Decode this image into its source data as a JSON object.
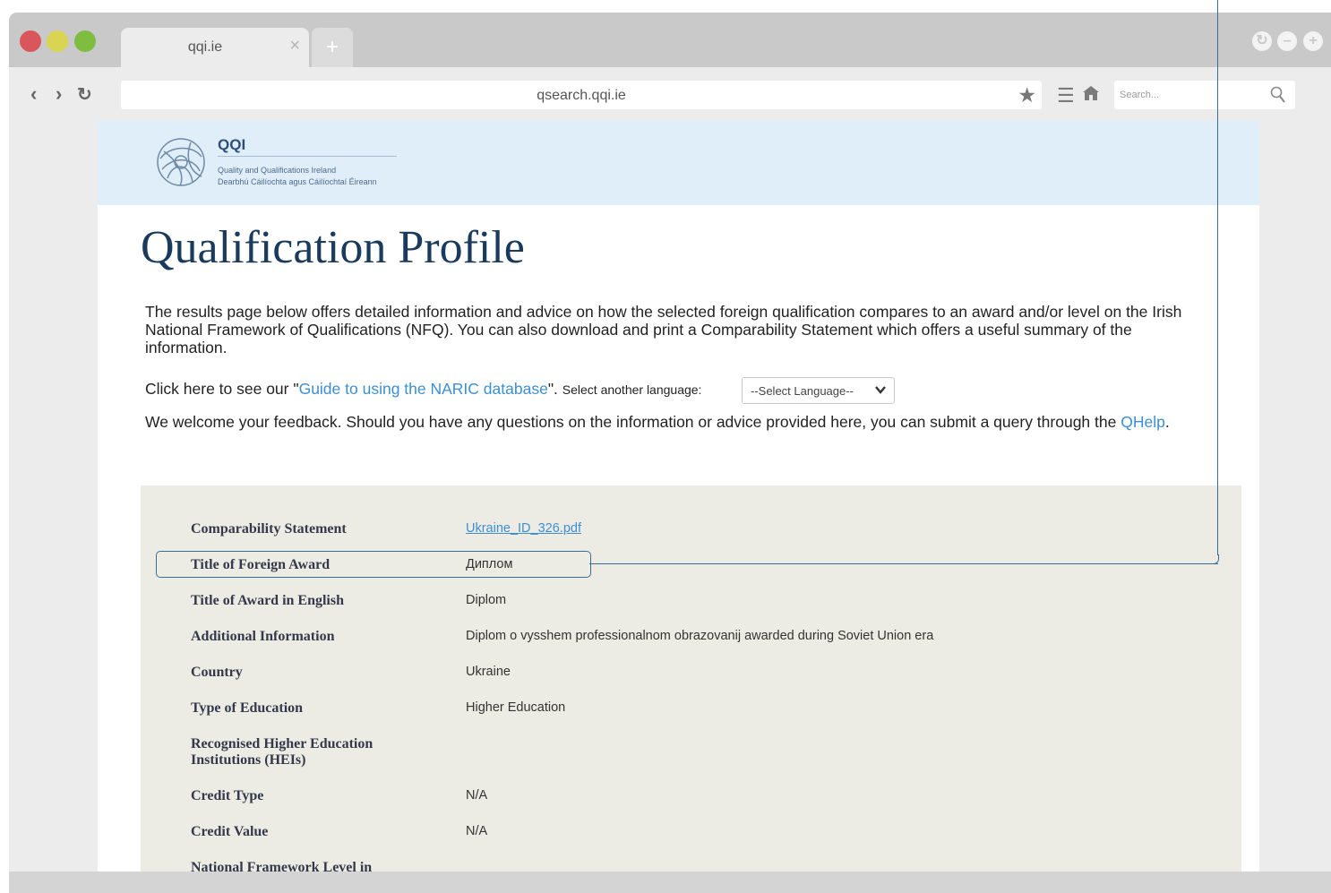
{
  "browser": {
    "tab_title": "qqi.ie",
    "tab_close": "×",
    "new_tab": "+",
    "url": "qsearch.qqi.ie",
    "search_placeholder": "Search...",
    "colors": {
      "close": "#d9575b",
      "minimize": "#d9d553",
      "maximize": "#7ebd3f"
    }
  },
  "header": {
    "logo_name": "QQI",
    "logo_line1": "Quality and Qualifications Ireland",
    "logo_line2": "Dearbhú Cáilíochta agus Cáilíochtaí Éireann"
  },
  "main": {
    "title": "Qualification Profile",
    "intro": "The results page below offers detailed information and advice on how the selected foreign qualification compares to an award and/or level on the Irish National Framework of Qualifications (NFQ). You can also download and print a Comparability Statement which offers a useful summary of the information.",
    "guide_prefix": "Click here to see our \"",
    "guide_link": "Guide to using the NARIC database",
    "guide_suffix": "\".",
    "language_label": "Select another language:",
    "language_select": "--Select Language--",
    "feedback_text": "We welcome your feedback. Should you have any questions on the information or advice provided here, you can submit a query through the",
    "feedback_link": "QHelp",
    "feedback_end": "."
  },
  "profile": {
    "rows": [
      {
        "label": "Comparability Statement",
        "value": "Ukraine_ID_326.pdf"
      },
      {
        "label": "Title of Foreign Award",
        "value": "Диплом"
      },
      {
        "label": "Title of Award in English",
        "value": "Diplom"
      },
      {
        "label": "Additional Information",
        "value": "Diplom o vysshem professionalnom obrazovanij awarded during Soviet Union era"
      },
      {
        "label": "Country",
        "value": "Ukraine"
      },
      {
        "label": "Type of Education",
        "value": "Higher Education"
      },
      {
        "label": "Recognised Higher Education Institutions (HEIs)",
        "value": ""
      },
      {
        "label": "Credit Type",
        "value": "N/A"
      },
      {
        "label": "Credit Value",
        "value": "N/A"
      },
      {
        "label": "National Framework Level in",
        "value": ""
      }
    ]
  }
}
